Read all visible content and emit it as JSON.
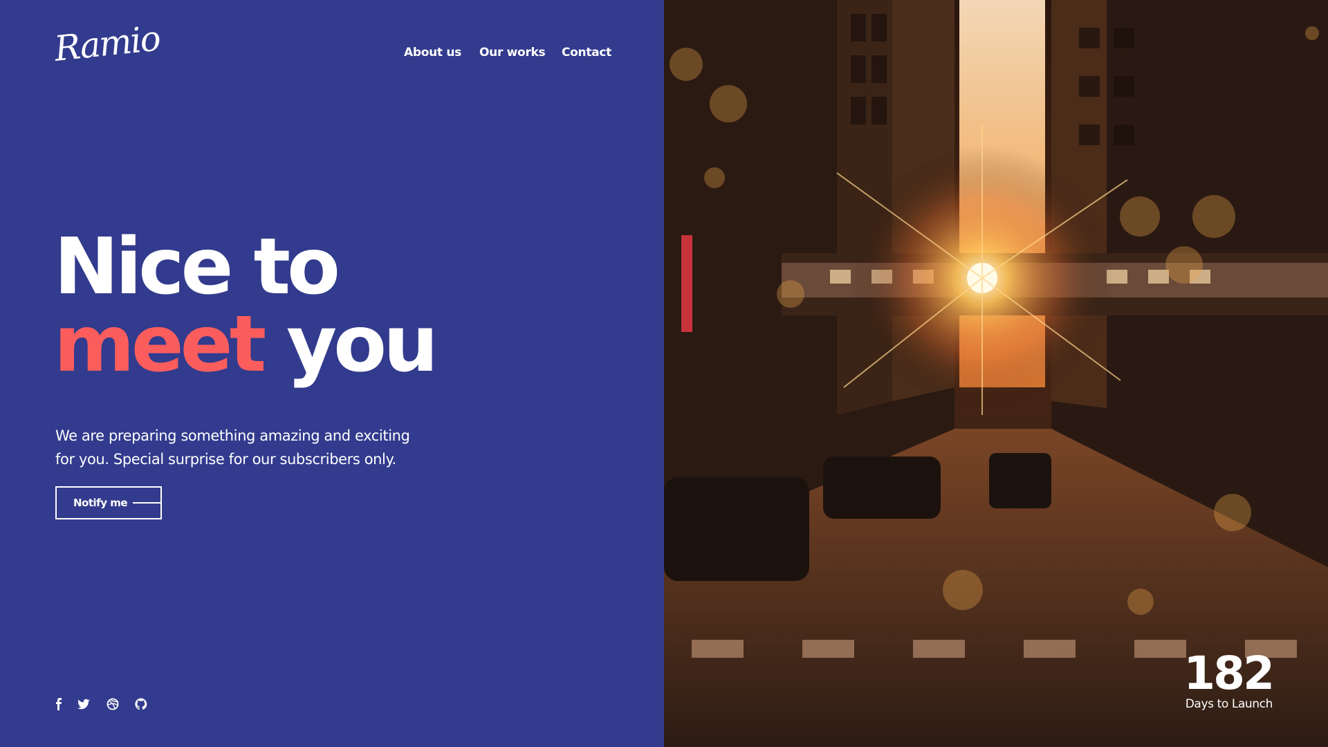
{
  "brand": {
    "logo_text": "Ramio"
  },
  "nav": {
    "items": [
      "About us",
      "Our works",
      "Contact"
    ]
  },
  "hero": {
    "title_line1": "Nice to",
    "title_accent": "meet",
    "title_line2_rest": "you",
    "description": "We are preparing something amazing and exciting for you. Special surprise for our subscribers only.",
    "cta_label": "Notify me"
  },
  "social": {
    "icons": [
      "facebook-icon",
      "twitter-icon",
      "dribbble-icon",
      "github-icon"
    ]
  },
  "countdown": {
    "value": "182",
    "label": "Days to Launch"
  },
  "colors": {
    "left_bg": "#323b8d",
    "accent": "#fb5d5d",
    "text": "#ffffff"
  }
}
